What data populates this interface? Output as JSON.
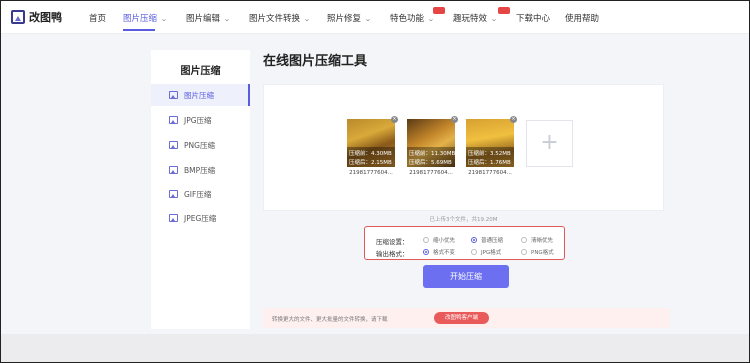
{
  "app": {
    "name": "改图鸭"
  },
  "nav": {
    "items": [
      {
        "label": "首页"
      },
      {
        "label": "图片压缩"
      },
      {
        "label": "图片编辑"
      },
      {
        "label": "图片文件转换"
      },
      {
        "label": "照片修复"
      },
      {
        "label": "特色功能"
      },
      {
        "label": "趣玩特效"
      },
      {
        "label": "下载中心"
      },
      {
        "label": "使用帮助"
      }
    ],
    "badges": [
      "hot-badge",
      "new-badge"
    ]
  },
  "sidebar": {
    "title": "图片压缩",
    "items": [
      {
        "label": "图片压缩"
      },
      {
        "label": "JPG压缩"
      },
      {
        "label": "PNG压缩"
      },
      {
        "label": "BMP压缩"
      },
      {
        "label": "GIF压缩"
      },
      {
        "label": "JPEG压缩"
      }
    ]
  },
  "main": {
    "title": "在线图片压缩工具",
    "images": [
      {
        "before": "压缩前：4.30MB",
        "after": "压缩后：2.15MB",
        "name": "21981777604..."
      },
      {
        "before": "压缩前：11.30MB",
        "after": "压缩后：5.69MB",
        "name": "21981777604..."
      },
      {
        "before": "压缩前：3.52MB",
        "after": "压缩后：1.76MB",
        "name": "21981777604..."
      }
    ],
    "add_symbol": "+",
    "upload_status": "已上传3个文件，共19.20M"
  },
  "settings": {
    "compress_label": "压缩设置：",
    "compress_options": [
      "缩小优先",
      "普通压缩",
      "清晰优先"
    ],
    "compress_selected": 1,
    "format_label": "输出格式：",
    "format_options": [
      "格式不变",
      "JPG格式",
      "PNG格式"
    ],
    "format_selected": 0
  },
  "start_button": "开始压缩",
  "hint": {
    "text": "转换更大的文件、更大批量的文件转换，请下载",
    "button": "改图鸭客户端"
  },
  "colors": {
    "accent": "#5a5ce0",
    "button": "#6b6ff0",
    "alert": "#e05858"
  }
}
